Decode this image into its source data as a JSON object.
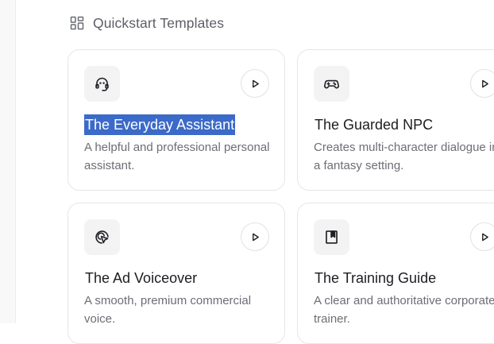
{
  "section": {
    "title": "Quickstart Templates",
    "icon": "grid-icon"
  },
  "cards": [
    {
      "title": "The Everyday Assistant",
      "description": "A helpful and professional personal assistant.",
      "icon": "headset-icon",
      "selected_text": true
    },
    {
      "title": "The Guarded NPC",
      "description": "Creates multi-character dialogue in a fantasy setting.",
      "icon": "gamepad-icon"
    },
    {
      "title": "The Ad Voiceover",
      "description": "A smooth, premium commercial voice.",
      "icon": "cursor-click-icon"
    },
    {
      "title": "The Training Guide",
      "description": "A clear and authoritative corporate trainer.",
      "icon": "bookmark-book-icon"
    }
  ],
  "colors": {
    "selection": "#3b6ac8",
    "card_border": "#e6e6ea",
    "icon_tile": "#f3f3f4",
    "muted_text": "#6c6e75"
  }
}
